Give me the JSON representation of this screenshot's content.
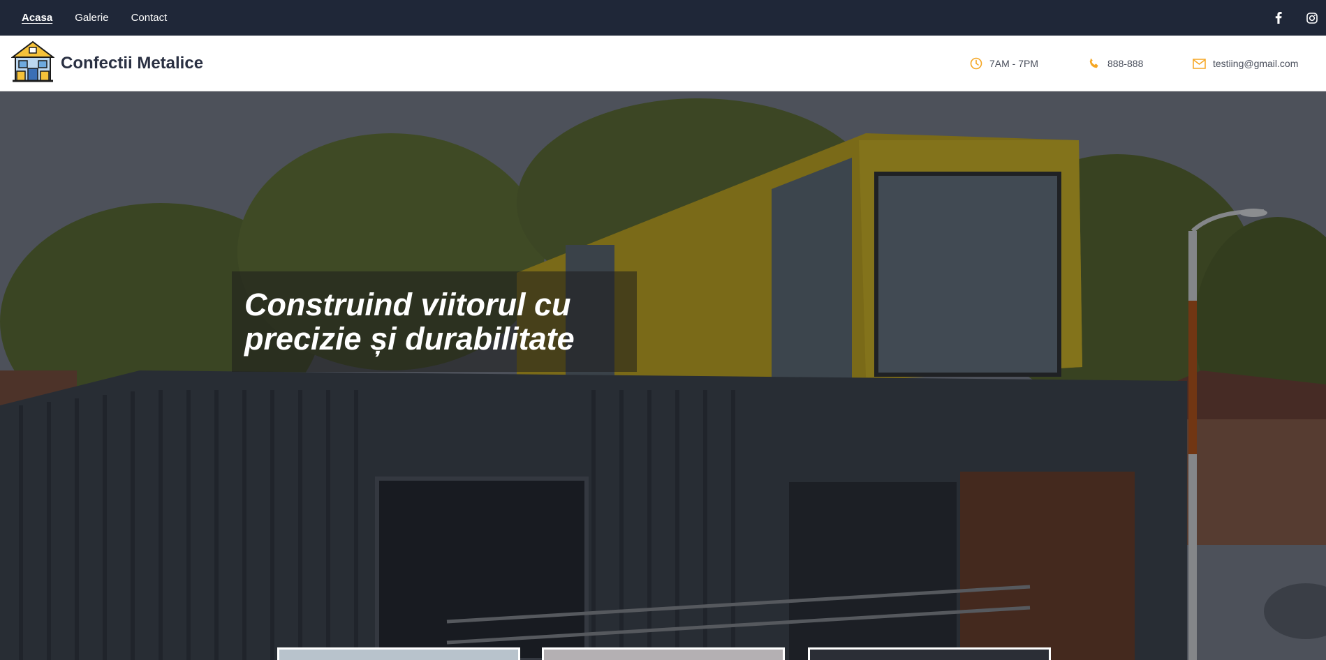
{
  "topnav": {
    "items": [
      {
        "label": "Acasa",
        "active": true
      },
      {
        "label": "Galerie",
        "active": false
      },
      {
        "label": "Contact",
        "active": false
      }
    ],
    "social": [
      "facebook-icon",
      "instagram-icon"
    ]
  },
  "header": {
    "brand": "Confectii Metalice",
    "hours": "7AM - 7PM",
    "phone": "888-888",
    "email": "testiing@gmail.com"
  },
  "hero": {
    "headline_line1": "Construind viitorul cu",
    "headline_line2": "precizie și durabilitate"
  },
  "colors": {
    "topbar": "#1f2738",
    "accent": "#f5a623",
    "brand_text": "#2a3042"
  }
}
